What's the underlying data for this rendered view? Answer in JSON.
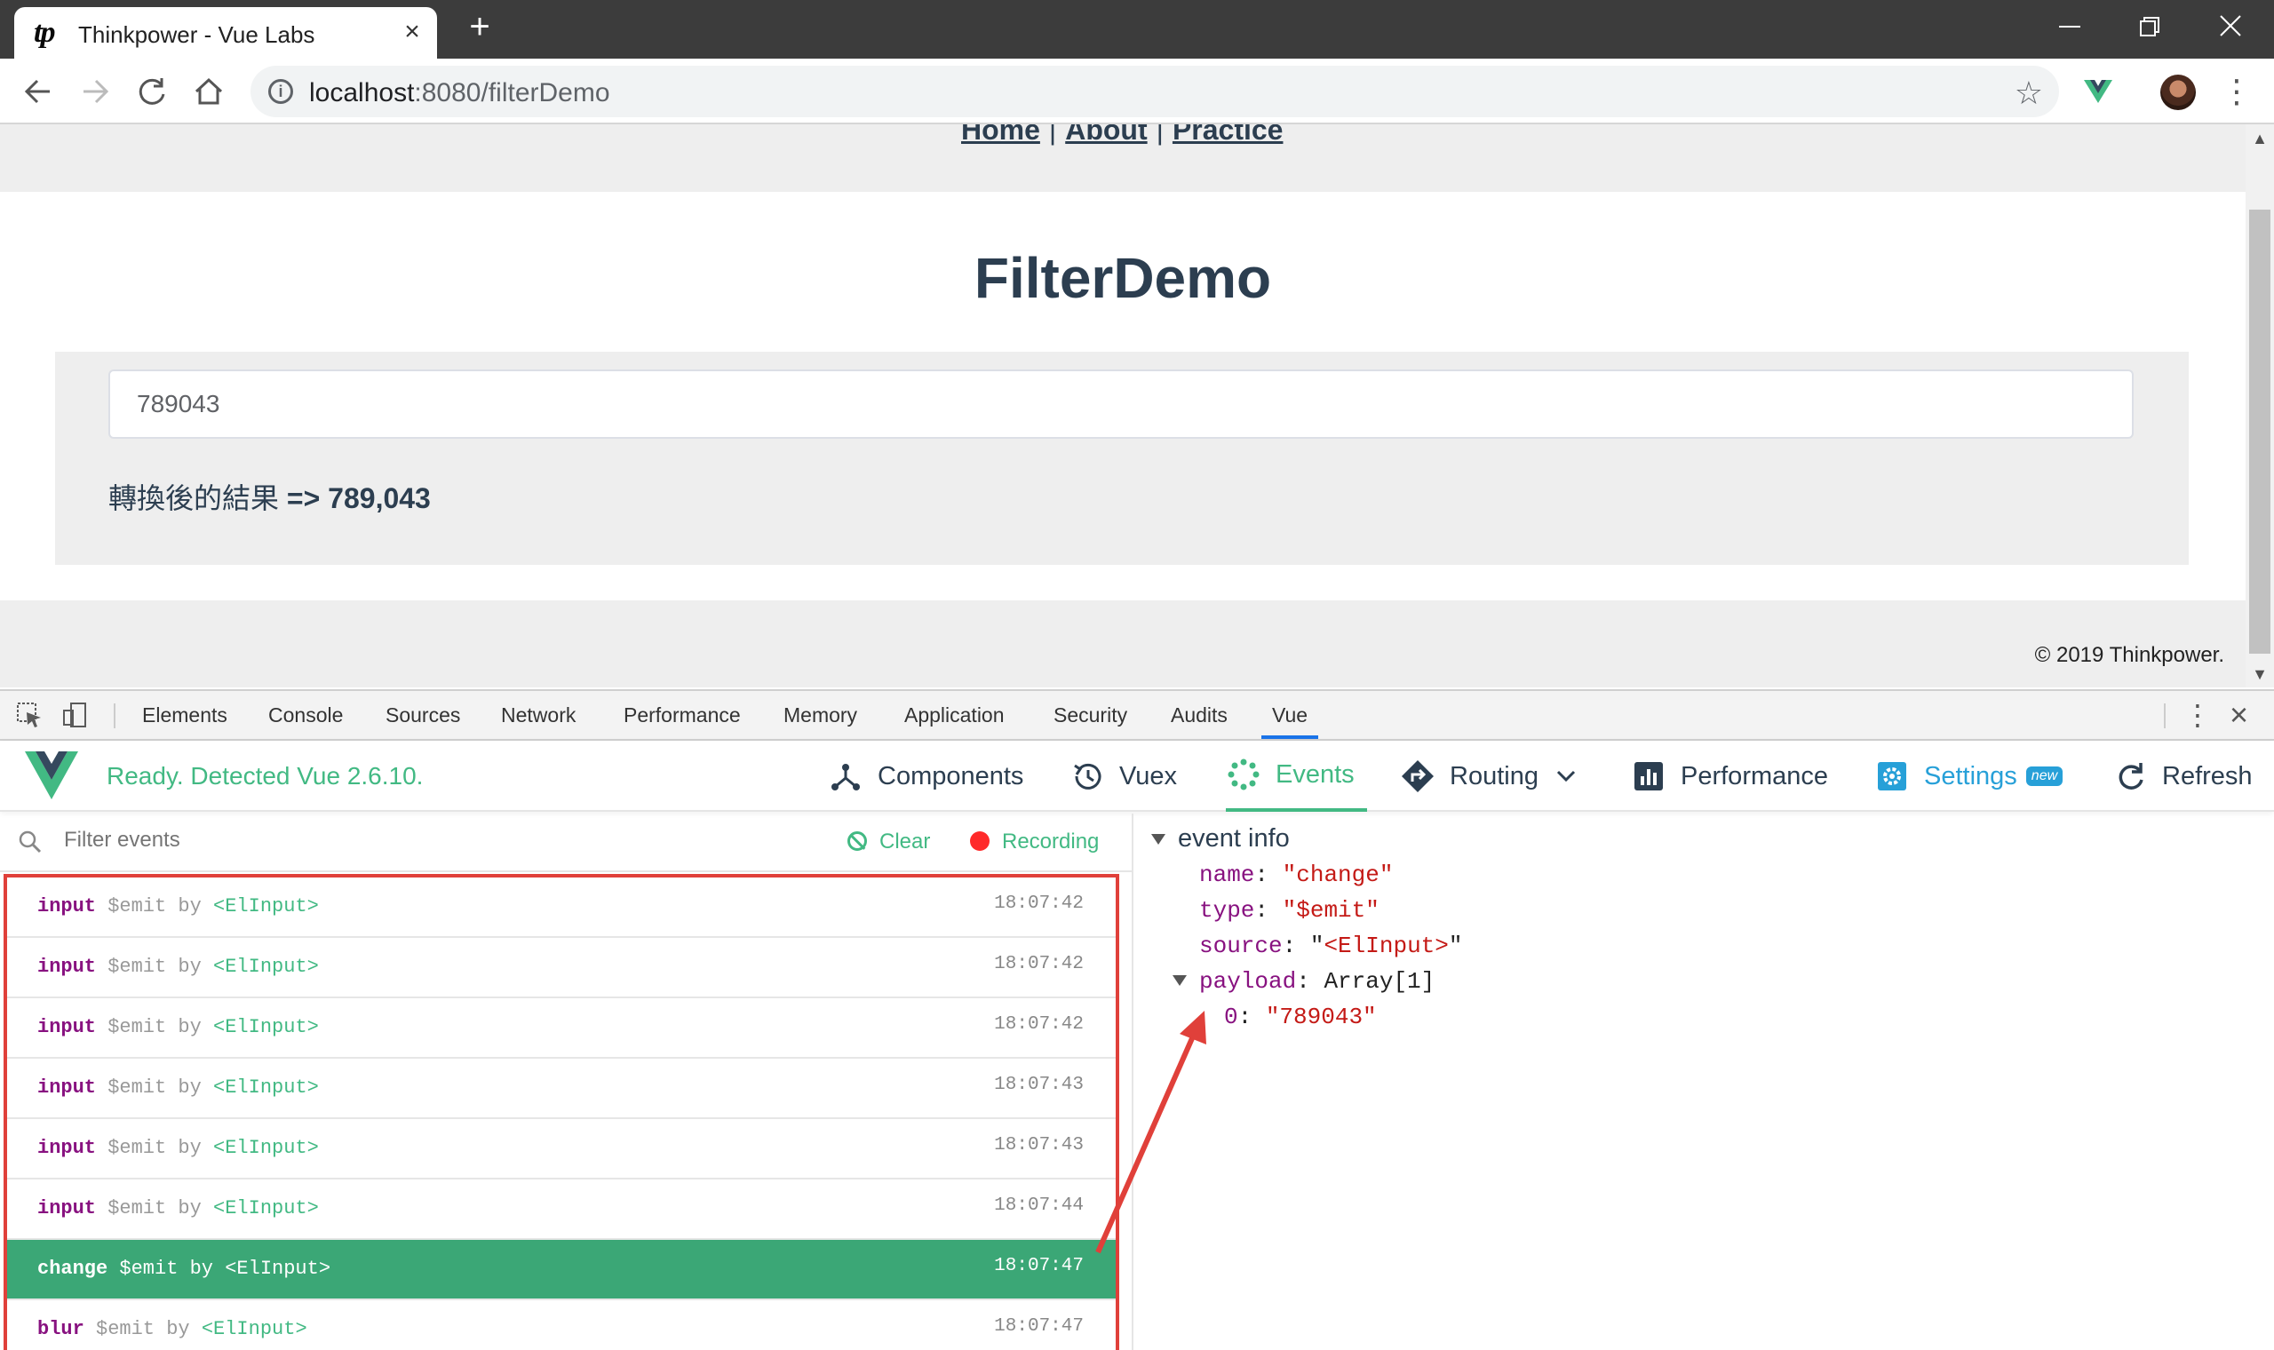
{
  "browser": {
    "tab_favicon": "tp",
    "tab_title": "Thinkpower - Vue Labs",
    "tab_close": "×",
    "new_tab": "+",
    "url_host": "localhost",
    "url_rest": ":8080/filterDemo",
    "icons": [
      "back-arrow-icon",
      "forward-arrow-icon",
      "reload-icon",
      "home-icon",
      "info-icon",
      "star-icon",
      "vue-devtools-extension-icon",
      "profile-avatar",
      "menu-dots-icon"
    ]
  },
  "page": {
    "nav": {
      "home": "Home",
      "about": "About",
      "practice": "Practice",
      "sep": "|"
    },
    "title": "FilterDemo",
    "input_value": "789043",
    "result_label": "轉換後的結果",
    "result_arrow": " => ",
    "result_value": "789,043",
    "copyright": "© 2019 Thinkpower."
  },
  "devtools": {
    "tabs": [
      "Elements",
      "Console",
      "Sources",
      "Network",
      "Performance",
      "Memory",
      "Application",
      "Security",
      "Audits",
      "Vue"
    ],
    "active_tab": "Vue",
    "vue": {
      "status": "Ready. Detected Vue 2.6.10.",
      "nav": {
        "components": "Components",
        "vuex": "Vuex",
        "events": "Events",
        "routing": "Routing",
        "performance": "Performance",
        "settings": "Settings",
        "settings_badge": "new",
        "refresh": "Refresh"
      },
      "filter_placeholder": "Filter events",
      "clear": "Clear",
      "recording": "Recording",
      "events": [
        {
          "name": "input",
          "desc": "$emit by",
          "comp": "<ElInput>",
          "time": "18:07:42",
          "selected": false
        },
        {
          "name": "input",
          "desc": "$emit by",
          "comp": "<ElInput>",
          "time": "18:07:42",
          "selected": false
        },
        {
          "name": "input",
          "desc": "$emit by",
          "comp": "<ElInput>",
          "time": "18:07:42",
          "selected": false
        },
        {
          "name": "input",
          "desc": "$emit by",
          "comp": "<ElInput>",
          "time": "18:07:43",
          "selected": false
        },
        {
          "name": "input",
          "desc": "$emit by",
          "comp": "<ElInput>",
          "time": "18:07:43",
          "selected": false
        },
        {
          "name": "input",
          "desc": "$emit by",
          "comp": "<ElInput>",
          "time": "18:07:44",
          "selected": false
        },
        {
          "name": "change",
          "desc": "$emit by",
          "comp": "<ElInput>",
          "time": "18:07:47",
          "selected": true
        },
        {
          "name": "blur",
          "desc": "$emit by",
          "comp": "<ElInput>",
          "time": "18:07:47",
          "selected": false
        }
      ],
      "event_info": {
        "title": "event info",
        "name_key": "name",
        "name_val": "\"change\"",
        "type_key": "type",
        "type_val": "\"$emit\"",
        "source_key": "source",
        "source_val_open": "\"",
        "source_val": "<ElInput>",
        "source_val_close": "\"",
        "payload_key": "payload",
        "payload_val": "Array[1]",
        "item_key": "0",
        "item_val": "\"789043\""
      }
    }
  },
  "colors": {
    "vue_green": "#42b983",
    "selected_row": "#3ba776",
    "annotation_red": "#e0403a",
    "settings_blue": "#27a0d8"
  }
}
